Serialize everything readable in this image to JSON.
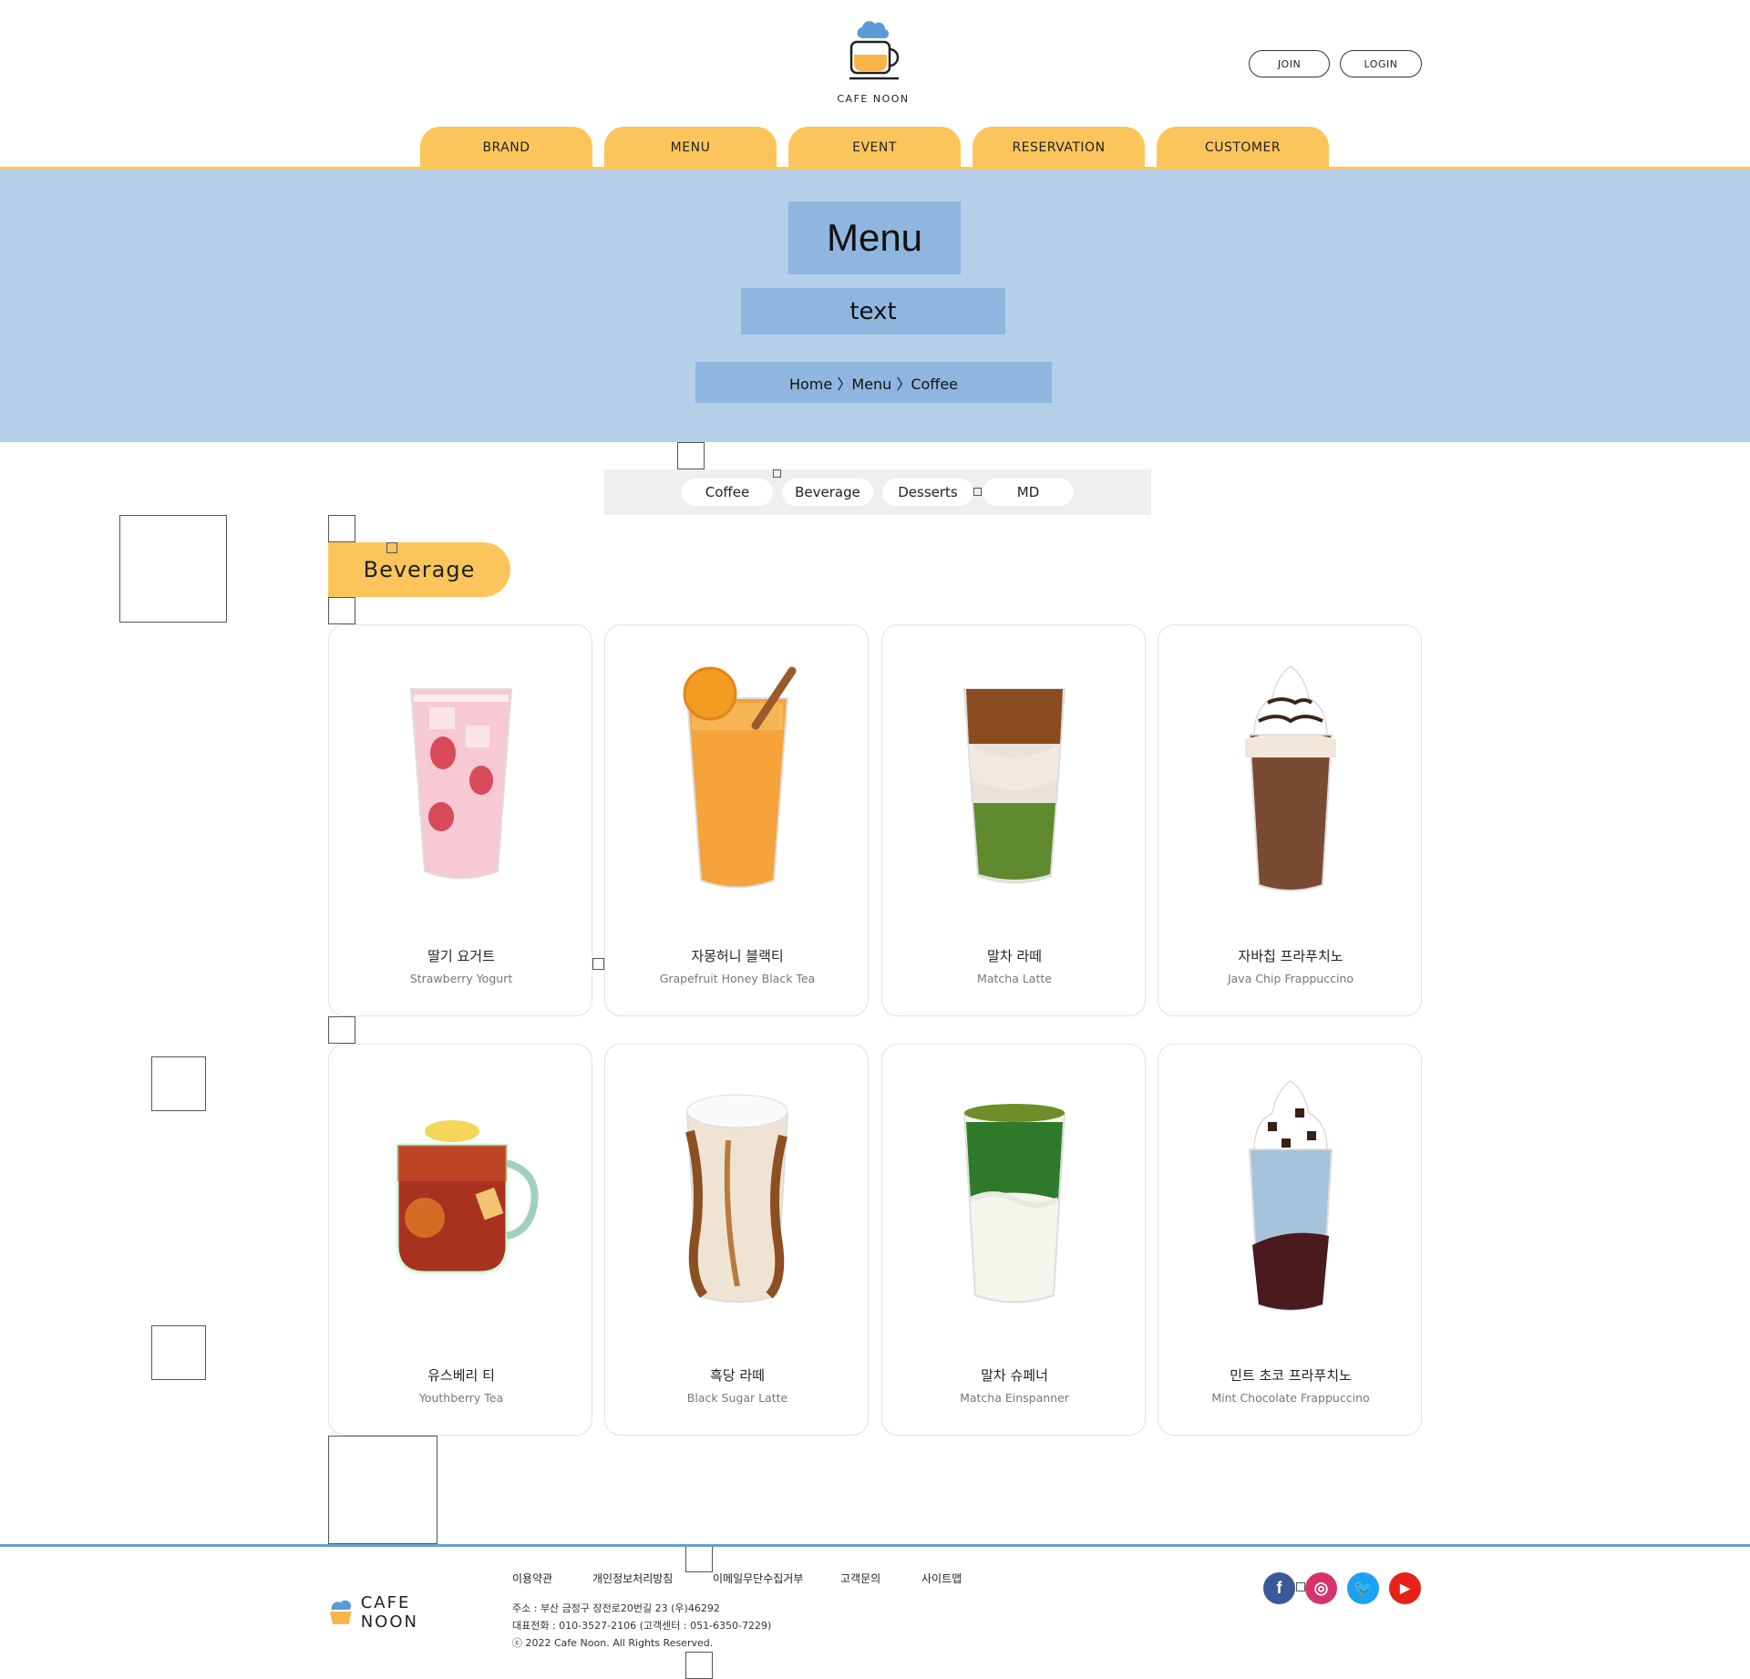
{
  "header": {
    "logo_text": "CAFE NOON",
    "join_label": "JOIN",
    "login_label": "LOGIN"
  },
  "nav": {
    "items": [
      {
        "label": "BRAND"
      },
      {
        "label": "MENU"
      },
      {
        "label": "EVENT"
      },
      {
        "label": "RESERVATION"
      },
      {
        "label": "CUSTOMER"
      }
    ]
  },
  "hero": {
    "title": "Menu",
    "subtitle": "text",
    "breadcrumb": "Home 〉Menu 〉Coffee"
  },
  "categories": [
    "Coffee",
    "Beverage",
    "Desserts",
    "MD"
  ],
  "section": {
    "title": "Beverage"
  },
  "products": [
    {
      "name_ko": "딸기 요거트",
      "name_en": "Strawberry Yogurt"
    },
    {
      "name_ko": "자몽허니 블랙티",
      "name_en": "Grapefruit Honey Black Tea"
    },
    {
      "name_ko": "말차 라떼",
      "name_en": "Matcha Latte"
    },
    {
      "name_ko": "자바칩 프라푸치노",
      "name_en": "Java Chip Frappuccino"
    },
    {
      "name_ko": "유스베리 티",
      "name_en": "Youthberry Tea"
    },
    {
      "name_ko": "흑당 라떼",
      "name_en": "Black Sugar Latte"
    },
    {
      "name_ko": "말차 슈페너",
      "name_en": "Matcha Einspanner"
    },
    {
      "name_ko": "민트 초코 프라푸치노",
      "name_en": "Mint Chocolate Frappuccino"
    }
  ],
  "footer": {
    "links": [
      "이용약관",
      "개인정보처리방침",
      "이메일무단수집거부",
      "고객문의",
      "사이트맵"
    ],
    "address": "주소 : 부산 금정구 장전로20번길 23 (우)46292",
    "phone": "대표전화 : 010-3527-2106 (고객센터 : 051-6350-7229)",
    "copyright": "ⓒ 2022 Cafe Noon. All Rights Reserved.",
    "logo_text": "CAFE NOON",
    "social": [
      {
        "icon": "facebook-icon",
        "glyph": "f",
        "color": "#3b5998"
      },
      {
        "icon": "instagram-icon",
        "glyph": "◎",
        "color": "#d6336c"
      },
      {
        "icon": "twitter-icon",
        "glyph": "🐦",
        "color": "#1da1f2"
      },
      {
        "icon": "youtube-icon",
        "glyph": "▶",
        "color": "#e62117"
      }
    ]
  },
  "colors": {
    "accent_yellow": "#fcc55c",
    "hero_bg": "#b5cfe9",
    "hero_box": "#8fb6df",
    "footer_line": "#6a9ed3"
  }
}
